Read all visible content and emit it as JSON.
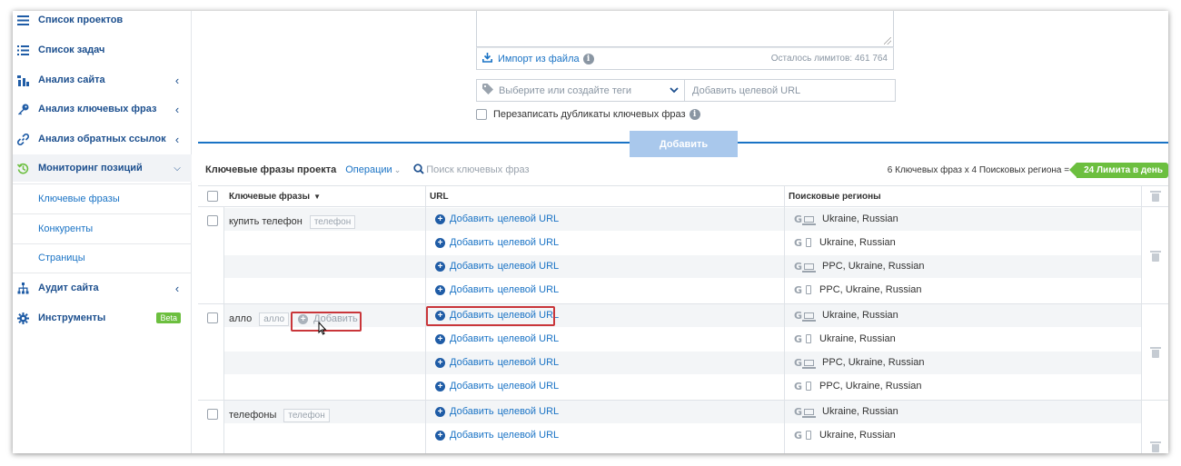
{
  "sidebar": {
    "items": [
      {
        "label": "Список проектов",
        "icon": "list-icon"
      },
      {
        "label": "Список задач",
        "icon": "tasks-icon"
      },
      {
        "label": "Анализ сайта",
        "icon": "site-analysis-icon"
      },
      {
        "label": "Анализ ключевых фраз",
        "icon": "key-icon"
      },
      {
        "label": "Анализ обратных ссылок",
        "icon": "link-icon"
      },
      {
        "label": "Мониторинг позиций",
        "icon": "monitoring-icon"
      },
      {
        "label": "Аудит сайта",
        "icon": "audit-icon"
      },
      {
        "label": "Инструменты",
        "icon": "gear-icon",
        "badge": "Beta"
      }
    ],
    "subitems": [
      {
        "label": "Ключевые фразы"
      },
      {
        "label": "Конкуренты"
      },
      {
        "label": "Страницы"
      }
    ]
  },
  "form": {
    "import_label": "Импорт из файла",
    "limits_text": "Осталось лимитов: 461 764",
    "tags_placeholder": "Выберите или создайте теги",
    "url_placeholder": "Добавить целевой URL",
    "overwrite_label": "Перезаписать дубликаты ключевых фраз",
    "add_button": "Добавить"
  },
  "toolbar": {
    "title": "Ключевые фразы проекта",
    "operations": "Операции",
    "search_placeholder": "Поиск ключевых фраз",
    "summary": "6 Ключевых фраз х 4 Поисковых региона =",
    "limit_badge": "24 Лимита в день"
  },
  "table": {
    "headers": {
      "keywords": "Ключевые фразы",
      "url": "URL",
      "regions": "Поисковые регионы"
    },
    "url_action_1": "Добавить",
    "url_action_2": "целевой URL",
    "add_tag_label": "Добавить",
    "groups": [
      {
        "phrase": "купить телефон",
        "tag": "телефон"
      },
      {
        "phrase": "алло",
        "tag": "алло"
      },
      {
        "phrase": "телефоны",
        "tag": "телефон"
      }
    ],
    "regions": [
      "Ukraine, Russian",
      "Ukraine, Russian",
      "PPC, Ukraine, Russian",
      "PPC, Ukraine, Russian",
      "Ukraine, Russian",
      "Ukraine, Russian",
      "PPC, Ukraine, Russian",
      "PPC, Ukraine, Russian",
      "Ukraine, Russian",
      "Ukraine, Russian"
    ],
    "g_letter": "G"
  },
  "colors": {
    "accent": "#1a73c5",
    "nav_text": "#1c4f8e",
    "badge_green": "#6cbf3f",
    "highlight_red": "#c9363a",
    "add_button_bg": "#a9c8ec"
  }
}
